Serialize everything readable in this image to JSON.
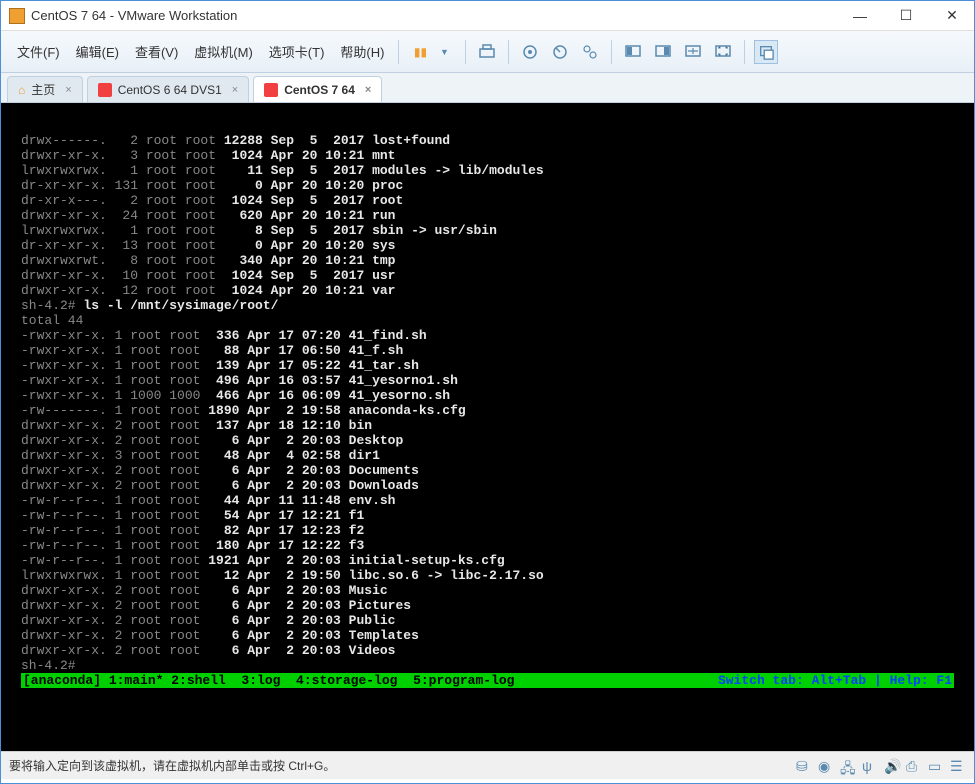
{
  "window": {
    "title": "CentOS 7 64  - VMware Workstation"
  },
  "menu": {
    "file": "文件(F)",
    "edit": "编辑(E)",
    "view": "查看(V)",
    "vm": "虚拟机(M)",
    "tabs": "选项卡(T)",
    "help": "帮助(H)"
  },
  "tabs": {
    "home": "主页",
    "t1": "CentOS 6 64 DVS1",
    "t2": "CentOS 7 64"
  },
  "terminal": {
    "lines": [
      {
        "type": "dir",
        "s": "drwx------.   2 root root 12288 Sep  5  2017 lost+found"
      },
      {
        "type": "dir",
        "s": "drwxr-xr-x.   3 root root  1024 Apr 20 10:21 mnt"
      },
      {
        "type": "dir",
        "s": "lrwxrwxrwx.   1 root root    11 Sep  5  2017 modules -> lib/modules"
      },
      {
        "type": "dir",
        "s": "dr-xr-xr-x. 131 root root     0 Apr 20 10:20 proc"
      },
      {
        "type": "dir",
        "s": "dr-xr-x---.   2 root root  1024 Sep  5  2017 root"
      },
      {
        "type": "dir",
        "s": "drwxr-xr-x.  24 root root   620 Apr 20 10:21 run"
      },
      {
        "type": "dir",
        "s": "lrwxrwxrwx.   1 root root     8 Sep  5  2017 sbin -> usr/sbin"
      },
      {
        "type": "dir",
        "s": "dr-xr-xr-x.  13 root root     0 Apr 20 10:20 sys"
      },
      {
        "type": "dir",
        "s": "drwxrwxrwt.   8 root root   340 Apr 20 10:21 tmp"
      },
      {
        "type": "dir",
        "s": "drwxr-xr-x.  10 root root  1024 Sep  5  2017 usr"
      },
      {
        "type": "dir",
        "s": "drwxr-xr-x.  12 root root  1024 Apr 20 10:21 var"
      },
      {
        "type": "cmd",
        "s": "sh-4.2# ls -l /mnt/sysimage/root/"
      },
      {
        "type": "txt",
        "s": "total 44"
      },
      {
        "type": "dir",
        "s": "-rwxr-xr-x. 1 root root  336 Apr 17 07:20 41_find.sh"
      },
      {
        "type": "dir",
        "s": "-rwxr-xr-x. 1 root root   88 Apr 17 06:50 41_f.sh"
      },
      {
        "type": "dir",
        "s": "-rwxr-xr-x. 1 root root  139 Apr 17 05:22 41_tar.sh"
      },
      {
        "type": "dir",
        "s": "-rwxr-xr-x. 1 root root  496 Apr 16 03:57 41_yesorno1.sh"
      },
      {
        "type": "dir",
        "s": "-rwxr-xr-x. 1 1000 1000  466 Apr 16 06:09 41_yesorno.sh"
      },
      {
        "type": "dir",
        "s": "-rw-------. 1 root root 1890 Apr  2 19:58 anaconda-ks.cfg"
      },
      {
        "type": "dir",
        "s": "drwxr-xr-x. 2 root root  137 Apr 18 12:10 bin"
      },
      {
        "type": "dir",
        "s": "drwxr-xr-x. 2 root root    6 Apr  2 20:03 Desktop"
      },
      {
        "type": "dir",
        "s": "drwxr-xr-x. 3 root root   48 Apr  4 02:58 dir1"
      },
      {
        "type": "dir",
        "s": "drwxr-xr-x. 2 root root    6 Apr  2 20:03 Documents"
      },
      {
        "type": "dir",
        "s": "drwxr-xr-x. 2 root root    6 Apr  2 20:03 Downloads"
      },
      {
        "type": "dir",
        "s": "-rw-r--r--. 1 root root   44 Apr 11 11:48 env.sh"
      },
      {
        "type": "dir",
        "s": "-rw-r--r--. 1 root root   54 Apr 17 12:21 f1"
      },
      {
        "type": "dir",
        "s": "-rw-r--r--. 1 root root   82 Apr 17 12:23 f2"
      },
      {
        "type": "dir",
        "s": "-rw-r--r--. 1 root root  180 Apr 17 12:22 f3"
      },
      {
        "type": "dir",
        "s": "-rw-r--r--. 1 root root 1921 Apr  2 20:03 initial-setup-ks.cfg"
      },
      {
        "type": "dir",
        "s": "lrwxrwxrwx. 1 root root   12 Apr  2 19:50 libc.so.6 -> libc-2.17.so"
      },
      {
        "type": "dir",
        "s": "drwxr-xr-x. 2 root root    6 Apr  2 20:03 Music"
      },
      {
        "type": "dir",
        "s": "drwxr-xr-x. 2 root root    6 Apr  2 20:03 Pictures"
      },
      {
        "type": "dir",
        "s": "drwxr-xr-x. 2 root root    6 Apr  2 20:03 Public"
      },
      {
        "type": "dir",
        "s": "drwxr-xr-x. 2 root root    6 Apr  2 20:03 Templates"
      },
      {
        "type": "dir",
        "s": "drwxr-xr-x. 2 root root    6 Apr  2 20:03 Videos"
      },
      {
        "type": "cmd",
        "s": "sh-4.2# "
      }
    ],
    "status_left": "[anaconda] 1:main* 2:shell  3:log  4:storage-log  5:program-log",
    "status_right": "Switch tab: Alt+Tab | Help: F1"
  },
  "bottombar": {
    "hint": "要将输入定向到该虚拟机，请在虚拟机内部单击或按 Ctrl+G。"
  }
}
